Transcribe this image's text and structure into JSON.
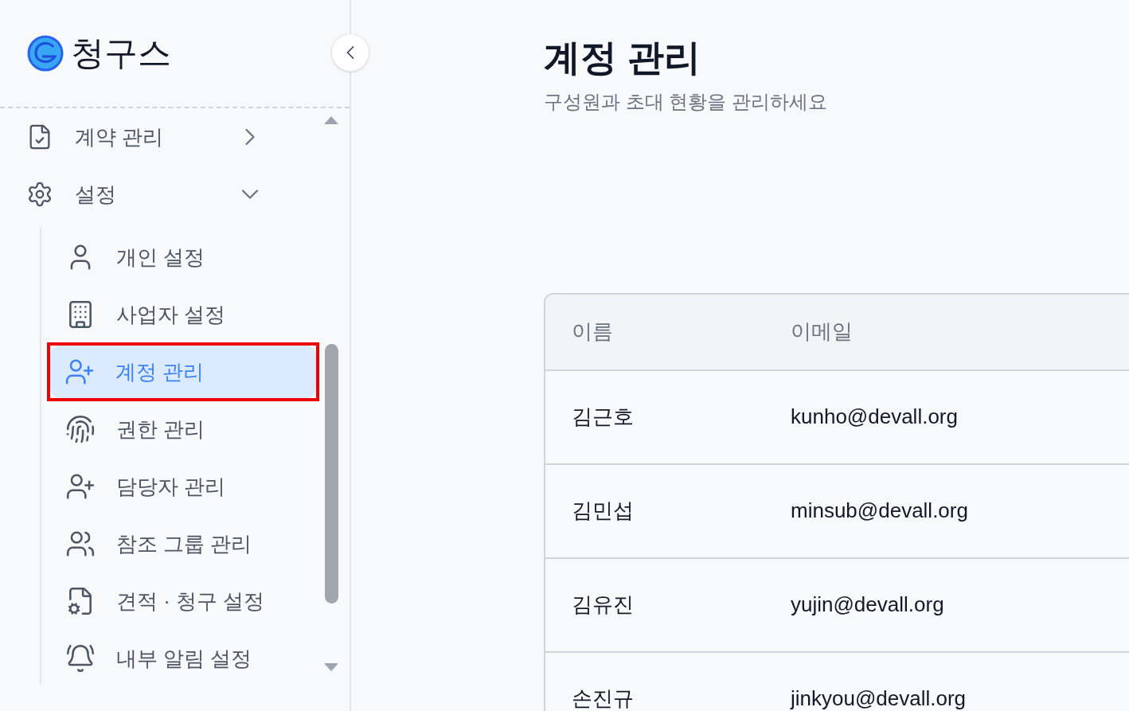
{
  "brand": {
    "name": "청구스"
  },
  "nav": [
    {
      "label": "계약 관리",
      "expanded": false
    },
    {
      "label": "설정",
      "expanded": true,
      "children": [
        {
          "label": "개인 설정",
          "selected": false
        },
        {
          "label": "사업자 설정",
          "selected": false
        },
        {
          "label": "계정 관리",
          "selected": true
        },
        {
          "label": "권한 관리",
          "selected": false
        },
        {
          "label": "담당자 관리",
          "selected": false
        },
        {
          "label": "참조 그룹 관리",
          "selected": false
        },
        {
          "label": "견적 · 청구 설정",
          "selected": false
        },
        {
          "label": "내부 알림 설정",
          "selected": false
        }
      ]
    }
  ],
  "page": {
    "title": "계정 관리",
    "subtitle": "구성원과 초대 현황을 관리하세요"
  },
  "table": {
    "columns": [
      "이름",
      "이메일"
    ],
    "rows": [
      {
        "name": "김근호",
        "email": "kunho@devall.org"
      },
      {
        "name": "김민섭",
        "email": "minsub@devall.org"
      },
      {
        "name": "김유진",
        "email": "yujin@devall.org"
      },
      {
        "name": "손진규",
        "email": "jinkyou@devall.org"
      }
    ]
  }
}
